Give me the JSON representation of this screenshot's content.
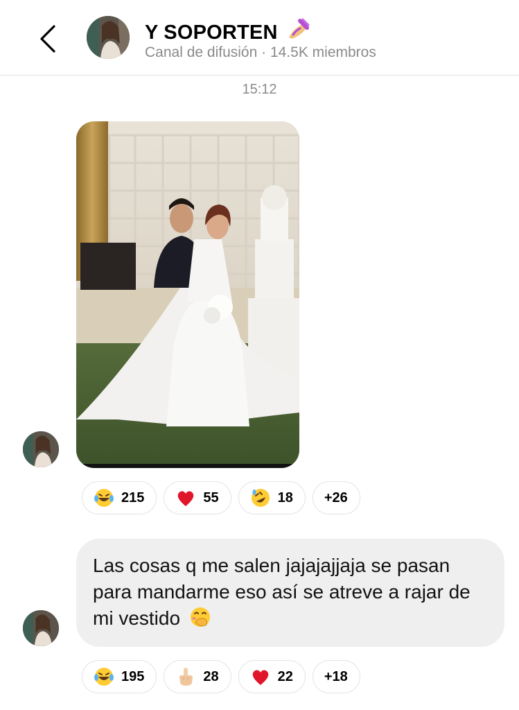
{
  "header": {
    "channel_name": "Y SOPORTEN",
    "channel_emoji_icon": "nail-polish-icon",
    "subtitle": "Canal de difusión · 14.5K miembros",
    "back_icon": "chevron-left-icon"
  },
  "timestamp": "15:12",
  "messages": [
    {
      "type": "image",
      "description_icon": "wedding-photo",
      "reactions": [
        {
          "icon": "laughing-tears-emoji",
          "count": "215"
        },
        {
          "icon": "red-heart-emoji",
          "count": "55"
        },
        {
          "icon": "rolling-laughing-emoji",
          "count": "18"
        },
        {
          "more": "+26"
        }
      ]
    },
    {
      "type": "text",
      "text": "Las cosas q me salen jajajajjaja se pasan para mandarme eso así se atreve a rajar de mi vestido",
      "trailing_emoji": "hand-over-mouth-emoji",
      "reactions": [
        {
          "icon": "laughing-tears-emoji",
          "count": "195"
        },
        {
          "icon": "middle-finger-emoji",
          "count": "28"
        },
        {
          "icon": "red-heart-emoji",
          "count": "22"
        },
        {
          "more": "+18"
        }
      ]
    }
  ],
  "colors": {
    "subtitle": "#8a8a8a",
    "bubble": "#efefef",
    "pill_border": "#e3e3e3",
    "heart": "#e0162b"
  }
}
